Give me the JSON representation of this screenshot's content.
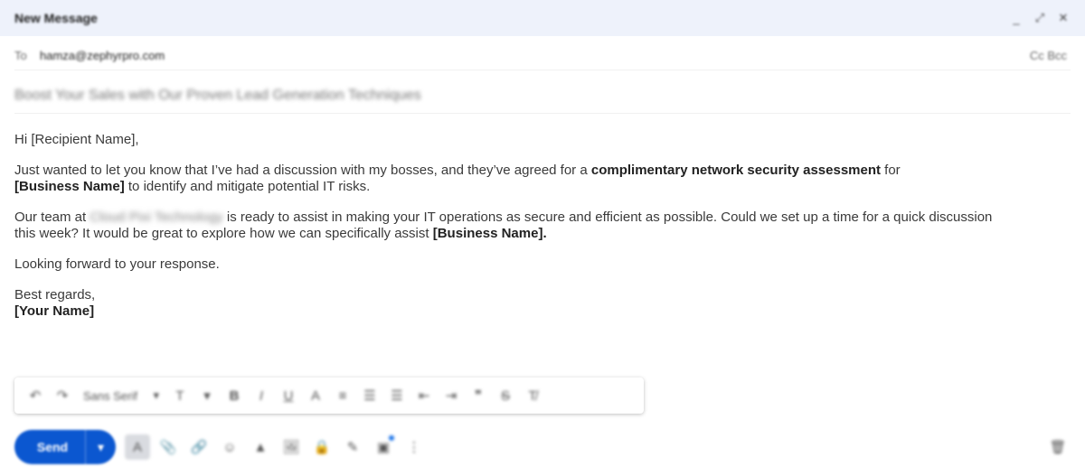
{
  "header": {
    "title": "New Message",
    "minimize": "_",
    "popout": "⤢",
    "close": "✕"
  },
  "recipients": {
    "to_label": "To",
    "to_value": "hamza@zephyrpro.com",
    "cc_bcc": "Cc Bcc"
  },
  "subject": "Boost Your Sales with Our Proven Lead Generation Techniques",
  "body": {
    "greeting": "Hi [Recipient Name],",
    "p1_a": "Just wanted to let you know that I’ve had a discussion with my bosses, and they’ve agreed for a ",
    "p1_bold": "complimentary network security assessment",
    "p1_b": " for ",
    "p1_bold2": "[Business Name]",
    "p1_c": " to identify and mitigate potential IT risks.",
    "p2_a": "Our team at ",
    "p2_company": "Cloud Pixi Technology",
    "p2_b": " is ready to assist in making your IT operations as secure and efficient as possible. Could we set up a time for a quick discussion this week? It would be great to explore how we can specifically assist ",
    "p2_bold": "[Business Name].",
    "p3": "Looking forward to your response.",
    "sign_off": "Best regards,",
    "name": "[Your Name]"
  },
  "format_toolbar": {
    "undo": "↶",
    "redo": "↷",
    "font": "Sans Serif",
    "font_arrow": "▾",
    "size": "T",
    "bold": "B",
    "italic": "I",
    "underline": "U",
    "text_color": "A",
    "align": "≡",
    "numbered": "☰",
    "bulleted": "☰",
    "indent_less": "⇤",
    "indent_more": "⇥",
    "quote": "❞",
    "strike": "S",
    "clear": "T̸"
  },
  "bottom_bar": {
    "send_label": "Send",
    "send_arrow": "▾",
    "tools": [
      "A",
      "📎",
      "🔗",
      "☺",
      "▲",
      "🖼",
      "🔒",
      "✎",
      "▣",
      "⋮"
    ],
    "trash": "🗑"
  }
}
